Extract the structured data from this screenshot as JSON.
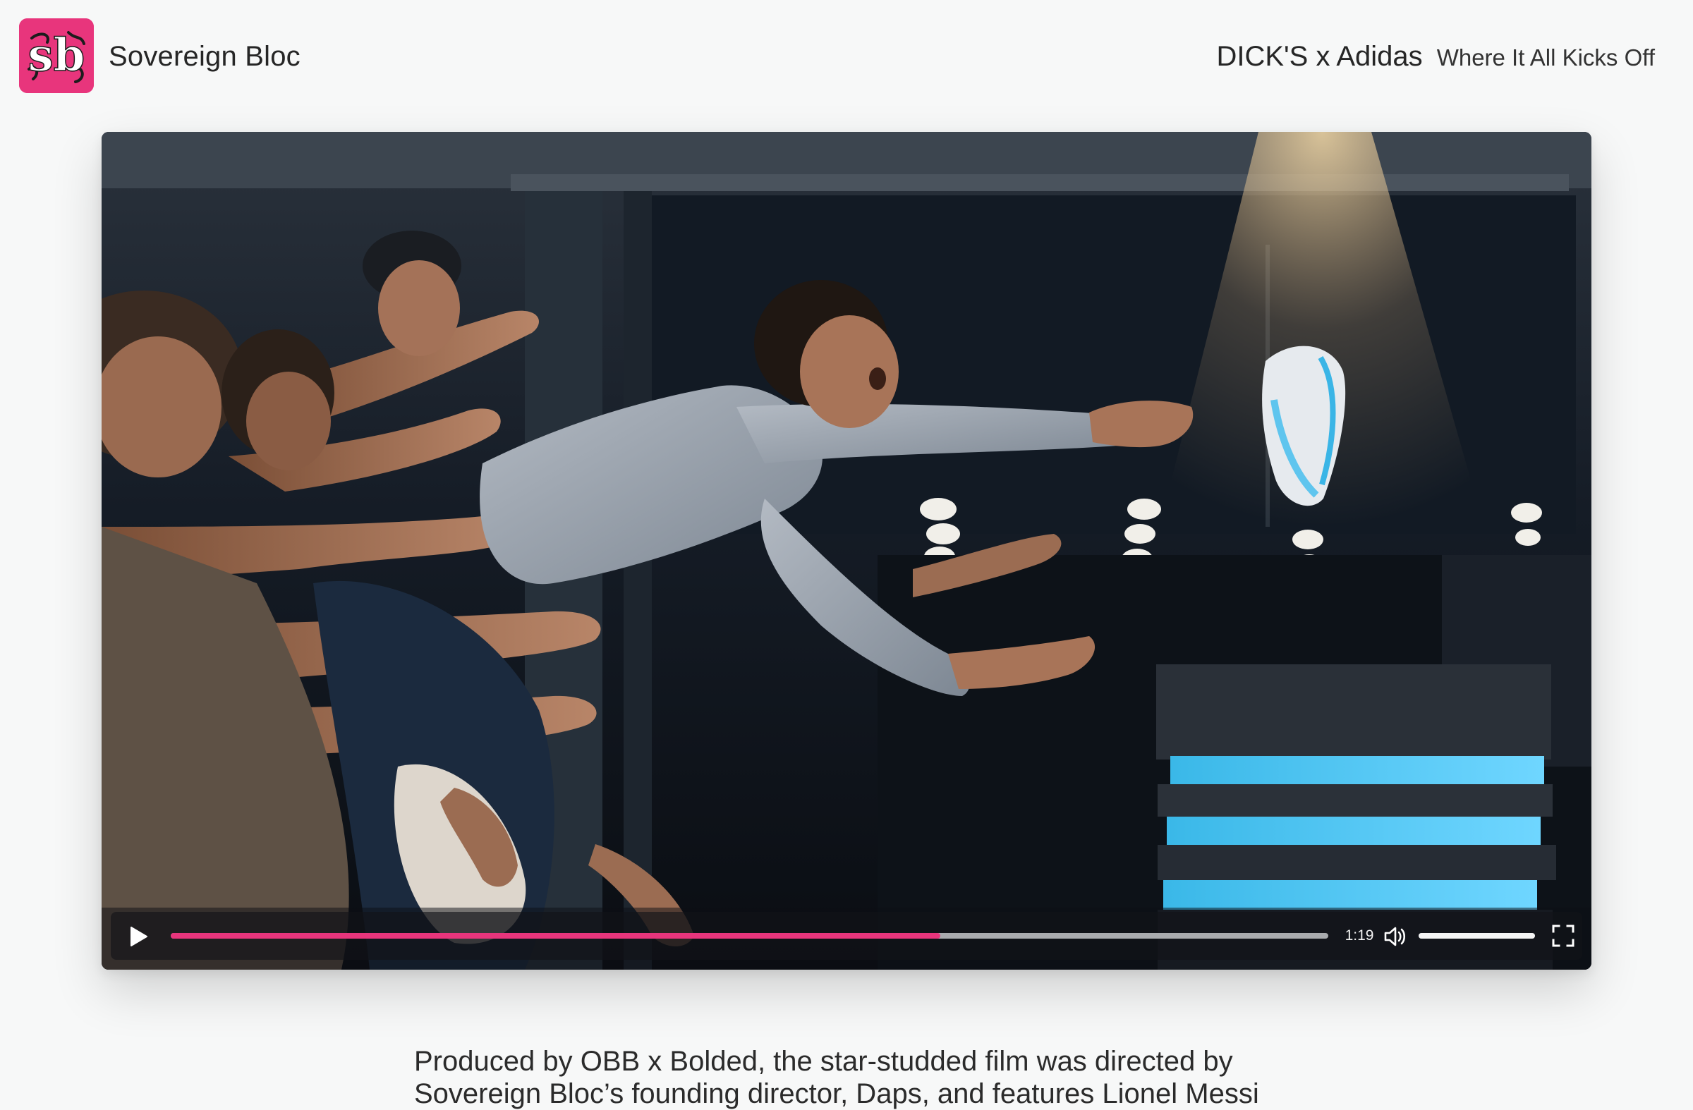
{
  "header": {
    "logo_text": "sb",
    "brand": "Sovereign Bloc",
    "project_title": "DICK'S x Adidas",
    "project_subtitle": "Where It All Kicks Off"
  },
  "video": {
    "time_label": "1:19",
    "progress": 0.665,
    "volume": 1.0,
    "colors": {
      "accent": "#e8357c",
      "track": "#a9abae"
    }
  },
  "description": {
    "line_1": "Produced by OBB x Bolded, the star-studded film was directed by",
    "line_2": "Sovereign Bloc’s founding director, Daps, and features Lionel Messi"
  },
  "icons": {
    "play": "play-icon",
    "volume": "volume-icon",
    "fullscreen": "fullscreen-icon"
  }
}
